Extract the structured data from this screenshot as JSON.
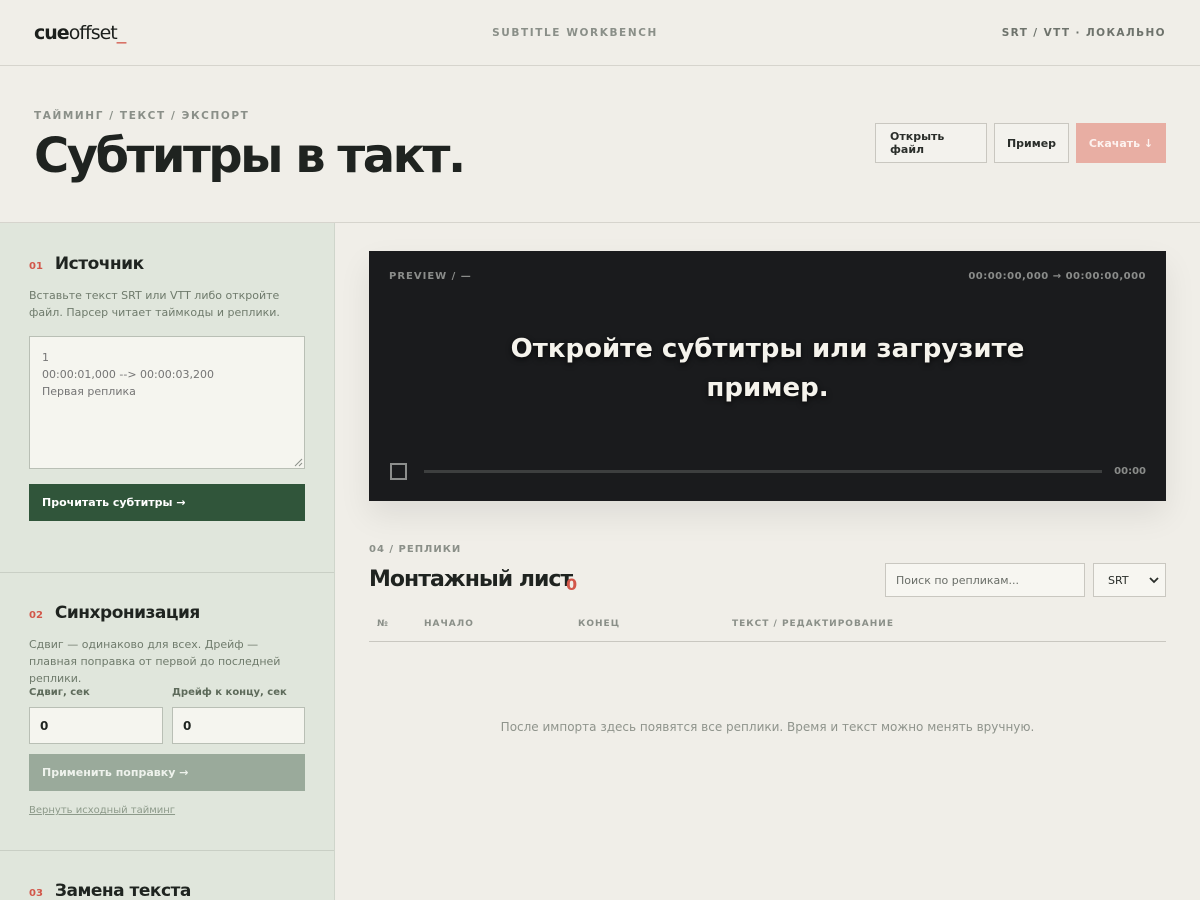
{
  "topbar": {
    "logo_bold": "cue",
    "logo_light": "offset",
    "logo_cursor": "_",
    "center": "SUBTITLE WORKBENCH",
    "right": "SRT / VTT · ЛОКАЛЬНО"
  },
  "hero": {
    "eyebrow": "ТАЙМИНГ / ТЕКСТ / ЭКСПОРТ",
    "title": "Субтитры в такт.",
    "open_file": "Открыть файл",
    "sample": "Пример",
    "download": "Скачать ↓"
  },
  "source": {
    "num": "01",
    "title": "Источник",
    "desc": "Вставьте текст SRT или VTT либо откройте файл. Парсер читает таймкоды и реплики.",
    "placeholder": "1\n00:00:01,000 --> 00:00:03,200\nПервая реплика",
    "read_button": "Прочитать субтитры →"
  },
  "sync": {
    "num": "02",
    "title": "Синхронизация",
    "desc": "Сдвиг — одинаково для всех. Дрейф — плавная поправка от первой до последней реплики.",
    "shift_label": "Сдвиг, сек",
    "shift_value": "0",
    "drift_label": "Дрейф к концу, сек",
    "drift_value": "0",
    "apply_button": "Применить поправку →",
    "reset_link": "Вернуть исходный тайминг"
  },
  "replace": {
    "num": "03",
    "title": "Замена текста"
  },
  "preview": {
    "label": "PREVIEW / —",
    "timecode": "00:00:00,000 → 00:00:00,000",
    "caption": "Откройте субтитры или загрузите пример.",
    "clock": "00:00"
  },
  "list": {
    "eyebrow": "04 / РЕПЛИКИ",
    "title": "Монтажный лист",
    "count": "0",
    "search_placeholder": "Поиск по репликам...",
    "format_selected": "SRT",
    "columns": [
      "№",
      "НАЧАЛО",
      "КОНЕЦ",
      "ТЕКСТ / РЕДАКТИРОВАНИЕ"
    ],
    "empty": "После импорта здесь появятся все реплики. Время и текст можно менять вручную."
  },
  "colors": {
    "accent": "#d2574a",
    "primary_button": "#30553a",
    "download_button": "#e8aea3",
    "sidebar_bg": "#e0e6dc",
    "preview_bg": "#1a1b1d"
  }
}
